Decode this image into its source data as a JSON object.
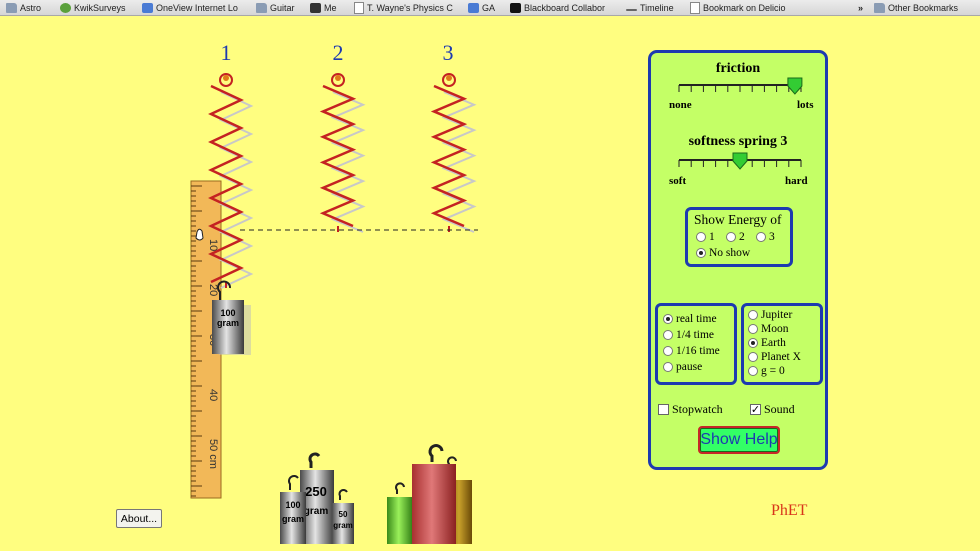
{
  "bookmarks": [
    {
      "label": "Astro",
      "icon": "folder-icon"
    },
    {
      "label": "KwikSurveys",
      "icon": "kwiksurveys-icon"
    },
    {
      "label": "OneView Internet Lo",
      "icon": "google-icon"
    },
    {
      "label": "Guitar",
      "icon": "folder-icon"
    },
    {
      "label": "Me",
      "icon": "apple-icon"
    },
    {
      "label": "T. Wayne's Physics C",
      "icon": "page-icon"
    },
    {
      "label": "GA",
      "icon": "google-icon"
    },
    {
      "label": "Blackboard Collabor",
      "icon": "blackboard-icon"
    },
    {
      "label": "Timeline",
      "icon": "timeline-icon"
    },
    {
      "label": "Bookmark on Delicio",
      "icon": "page-icon"
    }
  ],
  "bookmarks_overflow": "»",
  "other_bookmarks": "Other Bookmarks",
  "springs": [
    {
      "label": "1"
    },
    {
      "label": "2"
    },
    {
      "label": "3"
    }
  ],
  "ruler": {
    "ticks": [
      "10",
      "20",
      "30",
      "40",
      "50 cm"
    ]
  },
  "hanging_mass": {
    "line1": "100",
    "line2": "gram"
  },
  "shelf_masses": [
    {
      "line1": "100",
      "line2": "gram"
    },
    {
      "line1": "250",
      "line2": "gram"
    },
    {
      "line1": "50",
      "line2": "gram"
    }
  ],
  "controls": {
    "friction": {
      "title": "friction",
      "min_label": "none",
      "max_label": "lots",
      "value": 0.95
    },
    "softness": {
      "title": "softness spring 3",
      "min_label": "soft",
      "max_label": "hard",
      "value": 0.5
    },
    "energy": {
      "title": "Show Energy of",
      "options": [
        {
          "label": "1",
          "selected": false
        },
        {
          "label": "2",
          "selected": false
        },
        {
          "label": "3",
          "selected": false
        },
        {
          "label": "No show",
          "selected": true
        }
      ]
    },
    "time": {
      "options": [
        {
          "label": "real time",
          "selected": true
        },
        {
          "label": "1/4 time",
          "selected": false
        },
        {
          "label": "1/16 time",
          "selected": false
        },
        {
          "label": "pause",
          "selected": false
        }
      ]
    },
    "gravity": {
      "options": [
        {
          "label": "Jupiter",
          "selected": false
        },
        {
          "label": "Moon",
          "selected": false
        },
        {
          "label": "Earth",
          "selected": true
        },
        {
          "label": "Planet X",
          "selected": false
        },
        {
          "label": "g = 0",
          "selected": false
        }
      ]
    },
    "stopwatch": {
      "label": "Stopwatch",
      "checked": false
    },
    "sound": {
      "label": "Sound",
      "checked": true
    },
    "help_button": "Show Help"
  },
  "about_button": "About...",
  "brand": "PhET",
  "colors": {
    "background": "#fffe80",
    "panel": "#c4ff66",
    "panel_border": "#1d3ab0",
    "spring": "#c42222",
    "label_blue": "#1d3ab0",
    "brand": "#d8351a"
  }
}
